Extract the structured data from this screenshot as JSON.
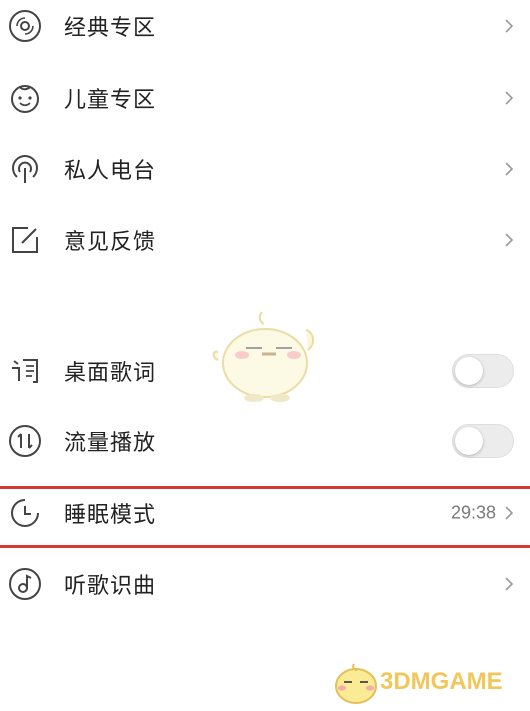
{
  "menu": {
    "items": [
      {
        "label": "经典专区",
        "icon": "vinyl-disc-icon"
      },
      {
        "label": "儿童专区",
        "icon": "baby-face-icon"
      },
      {
        "label": "私人电台",
        "icon": "radio-tower-icon"
      },
      {
        "label": "意见反馈",
        "icon": "edit-feedback-icon"
      }
    ]
  },
  "settings": {
    "desktop_lyrics": {
      "label": "桌面歌词",
      "enabled": false,
      "icon": "lyrics-text-icon"
    },
    "data_play": {
      "label": "流量播放",
      "enabled": false,
      "icon": "sort-arrows-icon"
    },
    "sleep_mode": {
      "label": "睡眠模式",
      "value": "29:38",
      "icon": "clock-icon",
      "highlight_color": "#d43a34"
    },
    "song_recognition": {
      "label": "听歌识曲",
      "icon": "music-note-icon"
    }
  },
  "watermark": {
    "text": "3DMGAME"
  }
}
